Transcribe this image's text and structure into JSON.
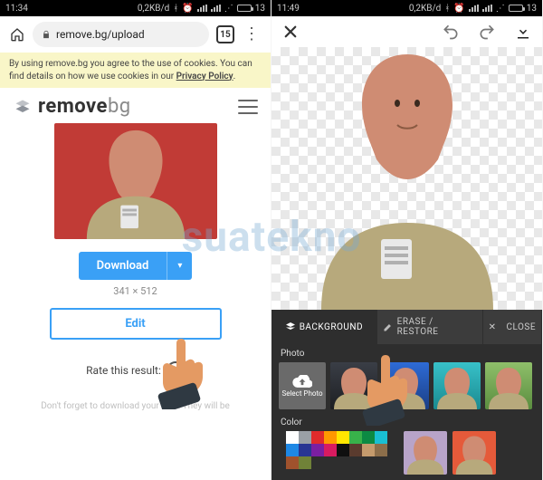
{
  "left": {
    "status": {
      "time": "11:34",
      "net": "0,2KB/d",
      "battery": "13"
    },
    "url": {
      "text": "remove.bg/upload"
    },
    "tabs_count": "15",
    "cookie": {
      "line1": "By using remove.bg you agree to the use of cookies. You can",
      "line2_a": "find details on how we use cookies in our ",
      "line2_b": "Privacy Policy",
      "line2_c": "."
    },
    "brand": {
      "a": "remove",
      "b": "bg"
    },
    "download_label": "Download",
    "image_dim": "341 × 512",
    "edit_label": "Edit",
    "rate_label": "Rate this result:",
    "hint": "Don't forget to download your files. They will be"
  },
  "right": {
    "status": {
      "time": "11:49",
      "net": "0,2KB/d",
      "battery": "13"
    },
    "tabs": {
      "bg": "BACKGROUND",
      "erase": "ERASE / RESTORE",
      "close": "CLOSE"
    },
    "section_photo": "Photo",
    "upload_label": "Select Photo",
    "section_color": "Color",
    "swatches": [
      "#ffffff",
      "#9aa0a6",
      "#df2b2b",
      "#ff9800",
      "#ffe600",
      "#38b24a",
      "#0c8a43",
      "#19bfd3",
      "#1e88e5",
      "#283593",
      "#7b1fa2",
      "#d81b60",
      "#0f0f0f",
      "#5a3b2e",
      "#c59b6d",
      "#8c6e4a",
      "#a0522d",
      "#708238"
    ]
  },
  "watermark": "suatekno"
}
